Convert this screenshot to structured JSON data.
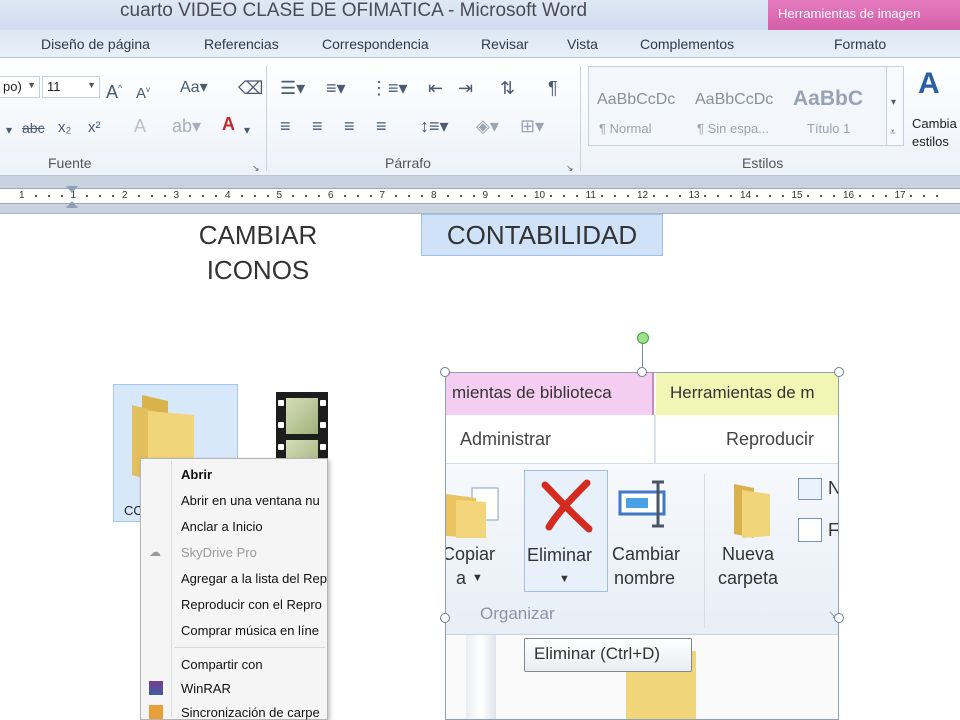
{
  "window": {
    "title": "cuarto VIDEO CLASE DE OFIMATICA - Microsoft Word",
    "context_tab": "Herramientas de imagen"
  },
  "ribbon_tabs": [
    "Diseño de página",
    "Referencias",
    "Correspondencia",
    "Revisar",
    "Vista",
    "Complementos",
    "Formato"
  ],
  "font_group": {
    "font_name": "po)",
    "font_size": "11",
    "label": "Fuente"
  },
  "paragraph_group": {
    "label": "Párrafo"
  },
  "styles_group": {
    "label": "Estilos",
    "items": [
      {
        "sample": "AaBbCcDc",
        "name": "¶ Normal"
      },
      {
        "sample": "AaBbCcDc",
        "name": "¶ Sin espa..."
      },
      {
        "sample": "AaBbC",
        "name": "Título 1"
      }
    ],
    "change_styles_line1": "Cambia",
    "change_styles_line2": "estilos"
  },
  "ruler": {
    "numbers": [
      "1",
      "1",
      "2",
      "3",
      "4",
      "5",
      "6",
      "7",
      "8",
      "9",
      "10",
      "11",
      "12",
      "13",
      "14",
      "15",
      "16",
      "17"
    ]
  },
  "document": {
    "heading_left_line1": "CAMBIAR",
    "heading_left_line2": "ICONOS",
    "heading_right": "CONTABILIDAD",
    "folder_caption": "CO"
  },
  "context_menu": {
    "items": [
      {
        "label": "Abrir",
        "style": "bold"
      },
      {
        "label": "Abrir en una ventana nu",
        "style": "normal"
      },
      {
        "label": "Anclar a Inicio",
        "style": "normal"
      },
      {
        "label": "SkyDrive Pro",
        "style": "disabled"
      },
      {
        "label": "Agregar a la lista del Rep",
        "style": "normal"
      },
      {
        "label": "Reproducir con el Repro",
        "style": "normal"
      },
      {
        "label": "Comprar música en líne",
        "style": "normal"
      },
      {
        "label": "Compartir con",
        "style": "normal"
      },
      {
        "label": "WinRAR",
        "style": "normal"
      },
      {
        "label": "Sincronización de carpe",
        "style": "normal"
      }
    ]
  },
  "embedded": {
    "tab_pink": "mientas de biblioteca",
    "tab_yellow": "Herramientas de m",
    "sub_left": "Administrar",
    "sub_right": "Reproducir",
    "btn_copy": "Copiar",
    "btn_copy_2": "a",
    "btn_delete": "Eliminar",
    "btn_rename_1": "Cambiar",
    "btn_rename_2": "nombre",
    "btn_newfolder_1": "Nueva",
    "btn_newfolder_2": "carpeta",
    "side_1": "N",
    "side_2": "F",
    "group_label": "Organizar",
    "tooltip": "Eliminar (Ctrl+D)"
  },
  "colors": {
    "context_tab": "#d35ea8",
    "heading_highlight": "#cfe2f8",
    "delete_x": "#d42a1f",
    "folder": "#f0cf6a"
  }
}
